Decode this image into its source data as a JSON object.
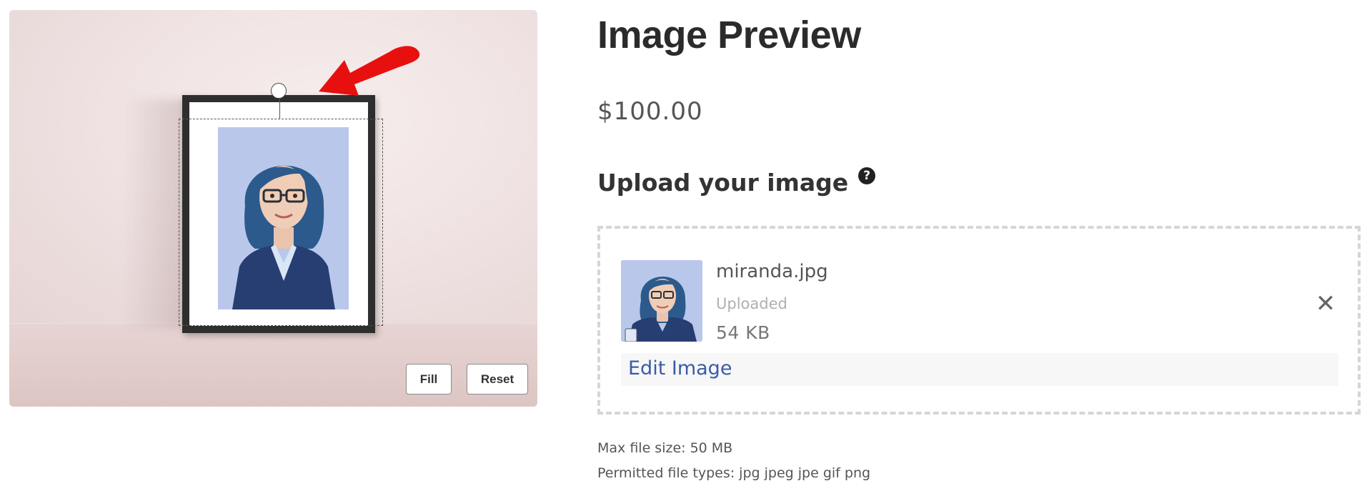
{
  "product": {
    "title": "Image Preview",
    "price": "$100.00"
  },
  "editor": {
    "fill_label": "Fill",
    "reset_label": "Reset",
    "annotation_arrow_color": "#e8100f"
  },
  "upload": {
    "heading": "Upload your image",
    "help_icon": "question-circle-icon",
    "help_glyph": "?",
    "file": {
      "name": "miranda.jpg",
      "status": "Uploaded",
      "size": "54 KB",
      "remove_icon": "close-icon",
      "remove_glyph": "✕"
    },
    "edit_label": "Edit Image",
    "max_size": "Max file size: 50 MB",
    "permitted_types": "Permitted file types: jpg jpeg jpe gif png"
  },
  "colors": {
    "link": "#3a5ba8",
    "accent_arrow": "#e8100f",
    "dropzone_border": "#d6d6d6"
  }
}
